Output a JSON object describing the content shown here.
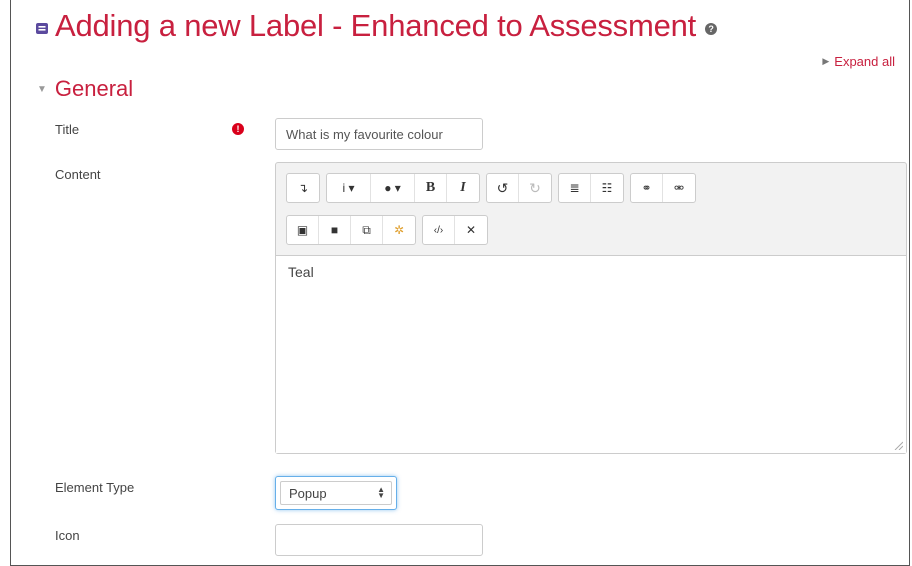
{
  "header": {
    "title": "Adding a new Label - Enhanced to Assessment",
    "help_glyph": "?"
  },
  "expand_all_label": "Expand all",
  "section": {
    "title": "General"
  },
  "form": {
    "title_label": "Title",
    "title_value": "What is my favourite colour",
    "required_glyph": "!",
    "content_label": "Content",
    "content_text": "Teal",
    "element_type_label": "Element Type",
    "element_type_value": "Popup",
    "icon_label": "Icon",
    "icon_value": ""
  },
  "toolbar": {
    "row1": [
      "↴",
      "i ▾",
      "● ▾",
      "B",
      "I",
      "↺",
      "↻",
      "≣",
      "☷",
      "⚭",
      "⚮"
    ],
    "row2": [
      "▣",
      "■",
      "⧉",
      "✲",
      "‹/›",
      "✕"
    ]
  },
  "colors": {
    "brand": "#c8203f",
    "required": "#d9001b",
    "focus": "#66afe9"
  },
  "icons": [
    "module-icon",
    "help-icon",
    "expand-triangle-icon",
    "collapse-caret-icon",
    "required-icon",
    "resize-handle-icon",
    "select-arrows-icon"
  ]
}
